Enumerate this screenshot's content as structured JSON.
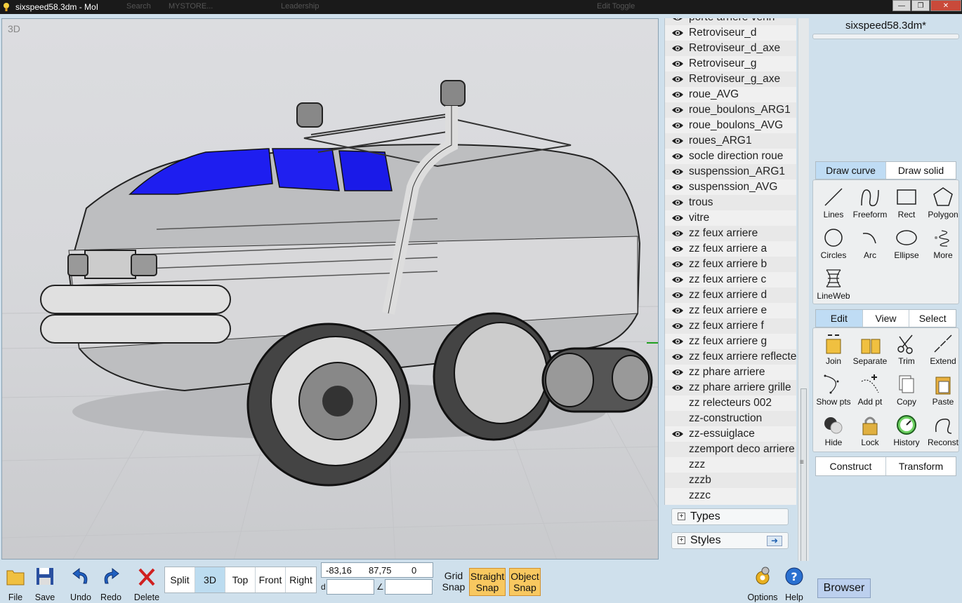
{
  "window": {
    "title": "sixspeed58.3dm - MoI",
    "faded_items": [
      "Search",
      "MYSTORE...",
      "Leadership",
      "Edit Toggle"
    ]
  },
  "viewport": {
    "label": "3D"
  },
  "layers": [
    {
      "name": "porte arriere verin",
      "visible": true
    },
    {
      "name": "Retroviseur_d",
      "visible": true
    },
    {
      "name": "Retroviseur_d_axe",
      "visible": true
    },
    {
      "name": "Retroviseur_g",
      "visible": true
    },
    {
      "name": "Retroviseur_g_axe",
      "visible": true
    },
    {
      "name": "roue_AVG",
      "visible": true
    },
    {
      "name": "roue_boulons_ARG1",
      "visible": true
    },
    {
      "name": "roue_boulons_AVG",
      "visible": true
    },
    {
      "name": "roues_ARG1",
      "visible": true
    },
    {
      "name": "socle direction roue",
      "visible": true
    },
    {
      "name": "suspenssion_ARG1",
      "visible": true
    },
    {
      "name": "suspenssion_AVG",
      "visible": true
    },
    {
      "name": "trous",
      "visible": true
    },
    {
      "name": "vitre",
      "visible": true
    },
    {
      "name": "zz feux arriere",
      "visible": true
    },
    {
      "name": "zz feux arriere a",
      "visible": true
    },
    {
      "name": "zz feux arriere b",
      "visible": true
    },
    {
      "name": "zz feux arriere c",
      "visible": true
    },
    {
      "name": "zz feux arriere d",
      "visible": true
    },
    {
      "name": "zz feux arriere e",
      "visible": true
    },
    {
      "name": "zz feux arriere f",
      "visible": true
    },
    {
      "name": "zz feux arriere g",
      "visible": true
    },
    {
      "name": "zz feux arriere reflecte",
      "visible": true
    },
    {
      "name": "zz phare arriere",
      "visible": true
    },
    {
      "name": "zz phare arriere grille",
      "visible": true
    },
    {
      "name": "zz relecteurs 002",
      "visible": false
    },
    {
      "name": "zz-construction",
      "visible": false
    },
    {
      "name": "zz-essuiglace",
      "visible": true
    },
    {
      "name": "zzemport deco arriere",
      "visible": false
    },
    {
      "name": "zzz",
      "visible": false
    },
    {
      "name": "zzzb",
      "visible": false
    },
    {
      "name": "zzzc",
      "visible": false
    }
  ],
  "sections": {
    "types": "Types",
    "styles": "Styles"
  },
  "panel": {
    "filename": "sixspeed58.3dm*",
    "draw_tabs": [
      "Draw curve",
      "Draw solid"
    ],
    "draw_tools": [
      "Lines",
      "Freeform",
      "Rect",
      "Polygon",
      "Circles",
      "Arc",
      "Ellipse",
      "More",
      "LineWeb"
    ],
    "edit_tabs": [
      "Edit",
      "View",
      "Select"
    ],
    "edit_tools": [
      "Join",
      "Separate",
      "Trim",
      "Extend",
      "Show pts",
      "Add pt",
      "Copy",
      "Paste",
      "Hide",
      "Lock",
      "History",
      "Reconst"
    ],
    "cmd_tabs": [
      "Construct",
      "Transform"
    ]
  },
  "bottom": {
    "file_buttons": [
      "File",
      "Save",
      "Undo",
      "Redo",
      "Delete"
    ],
    "views": [
      "Split",
      "3D",
      "Top",
      "Front",
      "Right"
    ],
    "coords": [
      "-83,16",
      "87,75",
      "0"
    ],
    "d_label": "d",
    "angle_label": "∠",
    "grid_snap": "Grid Snap",
    "straight_snap": "Straight Snap",
    "object_snap": "Object Snap",
    "options": "Options",
    "help": "Help",
    "browser": "Browser"
  },
  "colors": {
    "accent_tab": "#bfdcf4",
    "snap_on": "#f8c860",
    "windshield": "#1e1ef0"
  }
}
